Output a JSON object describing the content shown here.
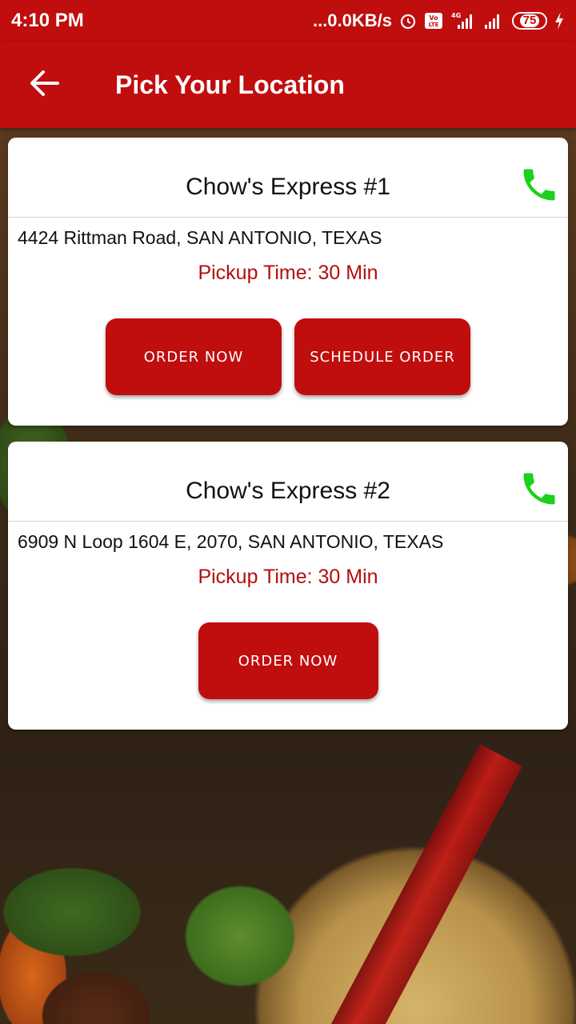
{
  "status_bar": {
    "time": "4:10 PM",
    "network_speed": "...0.0KB/s",
    "battery": "75"
  },
  "app_bar": {
    "title": "Pick Your Location"
  },
  "locations": [
    {
      "name": "Chow's Express #1",
      "address": "4424 Rittman Road, SAN ANTONIO, TEXAS",
      "pickup": "Pickup Time: 30 Min",
      "buttons": [
        "ORDER NOW",
        "SCHEDULE ORDER"
      ]
    },
    {
      "name": "Chow's Express #2",
      "address": "6909 N Loop 1604 E, 2070, SAN ANTONIO, TEXAS",
      "pickup": "Pickup Time: 30 Min",
      "buttons": [
        "ORDER NOW"
      ]
    }
  ],
  "colors": {
    "brand_red": "#c00d0d",
    "phone_green": "#1bd11b",
    "pickup_text": "#b30f0f"
  },
  "icons": {
    "back": "arrow-left-icon",
    "phone": "phone-icon",
    "alarm": "alarm-icon",
    "volte": "volte-icon",
    "signal": "signal-icon",
    "charging": "charging-icon"
  }
}
